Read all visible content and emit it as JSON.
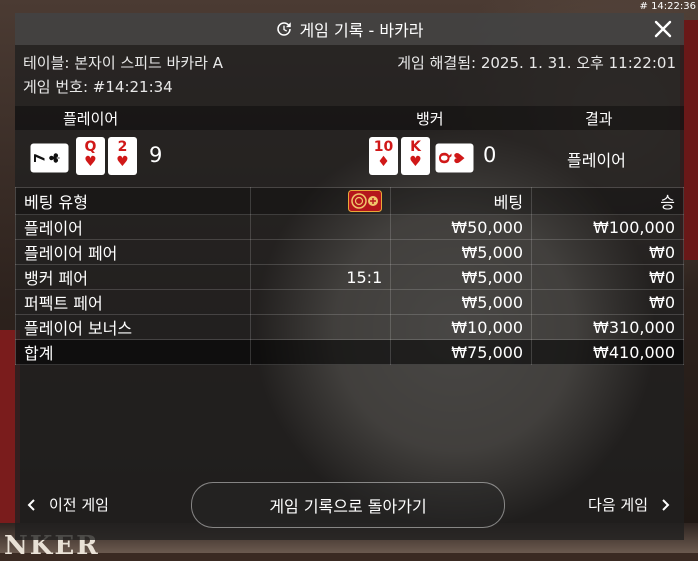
{
  "timestamp": "# 14:22:36",
  "title": "게임 기록 - 바카라",
  "icons": {
    "history": "history-clock-icon",
    "close": "close-icon",
    "chip": "bonus-chip-icon"
  },
  "meta": {
    "table": "테이블: 본자이 스피드 바카라 A",
    "resolved": "게임 해결됨: 2025. 1. 31. 오후 11:22:01",
    "game_no": "게임 번호: #14:21:34"
  },
  "columns": {
    "player": "플레이어",
    "banker": "뱅커",
    "result": "결과"
  },
  "hands": {
    "player": {
      "cards": [
        {
          "rank": "7",
          "suit": "♣",
          "color": "black",
          "rotated": true
        },
        {
          "rank": "Q",
          "suit": "♥",
          "color": "red",
          "rotated": false
        },
        {
          "rank": "2",
          "suit": "♥",
          "color": "red",
          "rotated": false
        }
      ],
      "score": "9"
    },
    "banker": {
      "cards": [
        {
          "rank": "10",
          "suit": "♦",
          "color": "red",
          "rotated": false
        },
        {
          "rank": "K",
          "suit": "♥",
          "color": "red",
          "rotated": false
        },
        {
          "rank": "Q",
          "suit": "♥",
          "color": "red",
          "rotated": true
        }
      ],
      "score": "0"
    },
    "result": "플레이어"
  },
  "bets_table": {
    "headers": {
      "type": "베팅 유형",
      "bet": "베팅",
      "win": "승"
    },
    "rows": [
      {
        "type": "플레이어",
        "odds": "",
        "bet": "₩50,000",
        "win": "₩100,000"
      },
      {
        "type": "플레이어 페어",
        "odds": "",
        "bet": "₩5,000",
        "win": "₩0"
      },
      {
        "type": "뱅커 페어",
        "odds": "15:1",
        "bet": "₩5,000",
        "win": "₩0"
      },
      {
        "type": "퍼펙트 페어",
        "odds": "",
        "bet": "₩5,000",
        "win": "₩0"
      },
      {
        "type": "플레이어 보너스",
        "odds": "",
        "bet": "₩10,000",
        "win": "₩310,000"
      }
    ],
    "total": {
      "label": "합계",
      "bet": "₩75,000",
      "win": "₩410,000"
    }
  },
  "footer": {
    "prev": "이전 게임",
    "back": "게임 기록으로 돌아가기",
    "next": "다음 게임"
  },
  "background_text": "NKER",
  "colors": {
    "card_red": "#d01818",
    "card_black": "#111111",
    "panel": "#202020"
  }
}
